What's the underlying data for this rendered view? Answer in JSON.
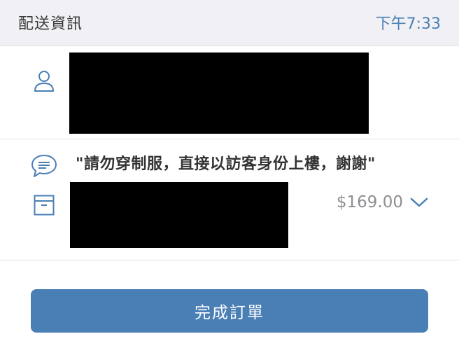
{
  "header": {
    "title": "配送資訊",
    "time": "下午7:33"
  },
  "customer": {
    "icon": "person-icon",
    "info": "[redacted]"
  },
  "order": {
    "note_icon": "chat-bubble-icon",
    "note": "\"請勿穿制服，直接以訪客身份上樓，謝謝\"",
    "items_icon": "box-icon",
    "items": "[redacted]",
    "price": "$169.00",
    "expand_icon": "chevron-down-icon"
  },
  "actions": {
    "complete_label": "完成訂單"
  },
  "colors": {
    "accent": "#4a7fb5",
    "header_bg": "#f1f1f5",
    "redaction": "#000000"
  }
}
